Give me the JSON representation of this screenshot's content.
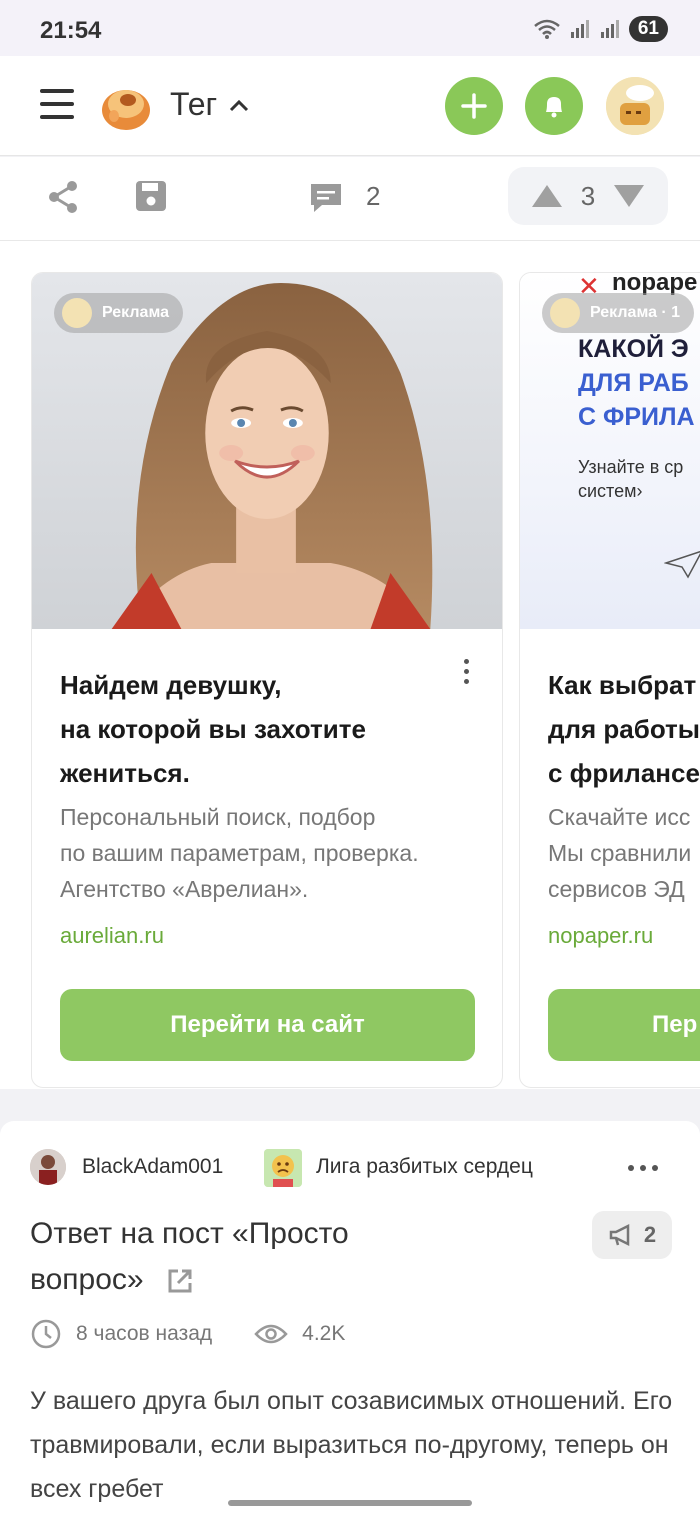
{
  "status_bar": {
    "time": "21:54",
    "battery": "61"
  },
  "header": {
    "title": "Тег"
  },
  "post_actions": {
    "comments_count": "2",
    "rating": "3"
  },
  "ads": [
    {
      "badge": "Реклама",
      "title": "Найдем девушку,\nна которой вы захотите\nжениться.",
      "description": "Персональный поиск, подбор\nпо вашим параметрам, проверка.\nАгентство «Аврелиан».",
      "domain": "aurelian.ru",
      "cta": "Перейти на сайт"
    },
    {
      "badge": "Реклама · 1",
      "hero_brand": "nopape",
      "hero_line1": "КАКОЙ Э",
      "hero_line2": "ДЛЯ РАБ",
      "hero_line3": "С ФРИЛА",
      "hero_sub1": "Узнайте в ср",
      "hero_sub2": "систем›",
      "title": "Как выбрат\nдля работы\nс фрилансе",
      "description": "Скачайте исс\nМы сравнили\nсервисов ЭД",
      "domain": "nopaper.ru",
      "cta": "Пер"
    }
  ],
  "post": {
    "author": "BlackAdam001",
    "community": "Лига разбитых сердец",
    "title": "Ответ на пост «Просто вопрос»",
    "responses_count": "2",
    "time_ago": "8 часов назад",
    "views": "4.2K",
    "body": "У вашего друга был опыт созависимых отношений. Его травмировали, если выразиться по-другому, теперь он всех гребет"
  }
}
